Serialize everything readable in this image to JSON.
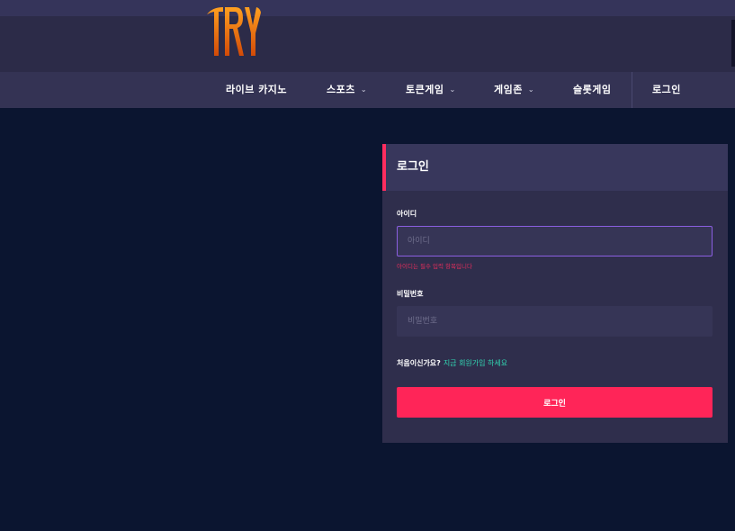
{
  "logo": {
    "text": "TRY",
    "color_top": "#ff8a10",
    "color_bottom": "#d4560a"
  },
  "nav": {
    "items": [
      {
        "label": "라이브 카지노",
        "dropdown": false
      },
      {
        "label": "스포츠",
        "dropdown": true
      },
      {
        "label": "토큰게임",
        "dropdown": true
      },
      {
        "label": "게임존",
        "dropdown": true
      },
      {
        "label": "슬롯게임",
        "dropdown": false
      },
      {
        "label": "로그인",
        "dropdown": false
      }
    ],
    "caret": "⌄"
  },
  "login_panel": {
    "title": "로그인",
    "username_label": "아이디",
    "username_placeholder": "아이디",
    "username_value": "",
    "username_error": "아이디는 필수 입력 항목입니다",
    "password_label": "비밀번호",
    "password_placeholder": "비밀번호",
    "password_value": "",
    "signup_prompt": "처음이신가요?",
    "signup_link": "지금 회원가입 하세요",
    "submit_label": "로그인"
  },
  "colors": {
    "background": "#0b1530",
    "accent": "#ff2558",
    "link": "#31d6b2",
    "focus_border": "#8a5ee0"
  }
}
